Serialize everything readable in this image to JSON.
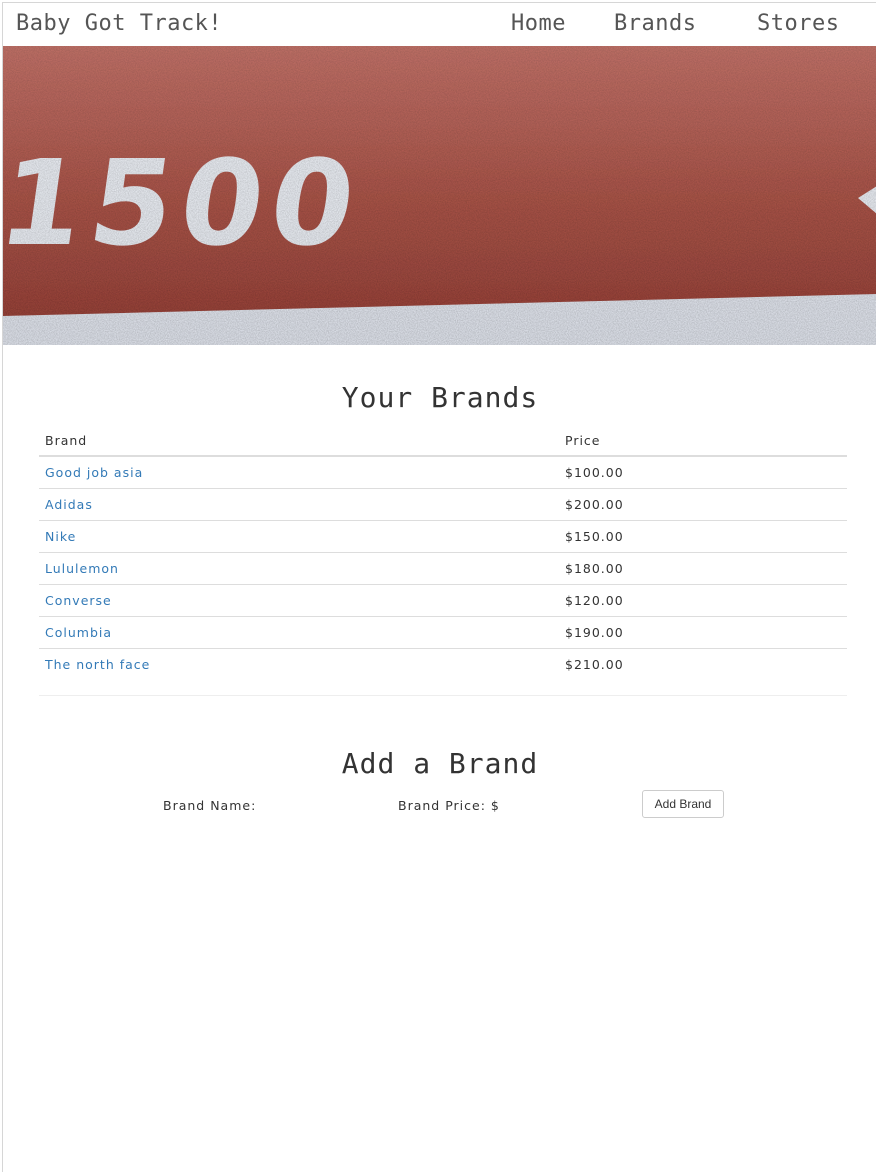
{
  "header": {
    "site_title": "Baby Got Track!",
    "nav": {
      "home": "Home",
      "brands": "Brands",
      "stores": "Stores"
    }
  },
  "hero": {
    "image_text": "1500",
    "colors": {
      "track": "#a8463a",
      "line": "#e9ecf2"
    }
  },
  "brands_section": {
    "title": "Your Brands",
    "columns": [
      "Brand",
      "Price"
    ],
    "rows": [
      {
        "brand": "Good job asia",
        "price": "$100.00"
      },
      {
        "brand": "Adidas",
        "price": "$200.00"
      },
      {
        "brand": "Nike",
        "price": "$150.00"
      },
      {
        "brand": "Lululemon",
        "price": "$180.00"
      },
      {
        "brand": "Converse",
        "price": "$120.00"
      },
      {
        "brand": "Columbia",
        "price": "$190.00"
      },
      {
        "brand": "The north face",
        "price": "$210.00"
      }
    ]
  },
  "add_section": {
    "title": "Add a Brand",
    "name_label": "Brand Name:",
    "price_label": "Brand Price: $",
    "button_label": "Add Brand"
  },
  "colors": {
    "link": "#337ab7",
    "nav_text": "#555555"
  }
}
